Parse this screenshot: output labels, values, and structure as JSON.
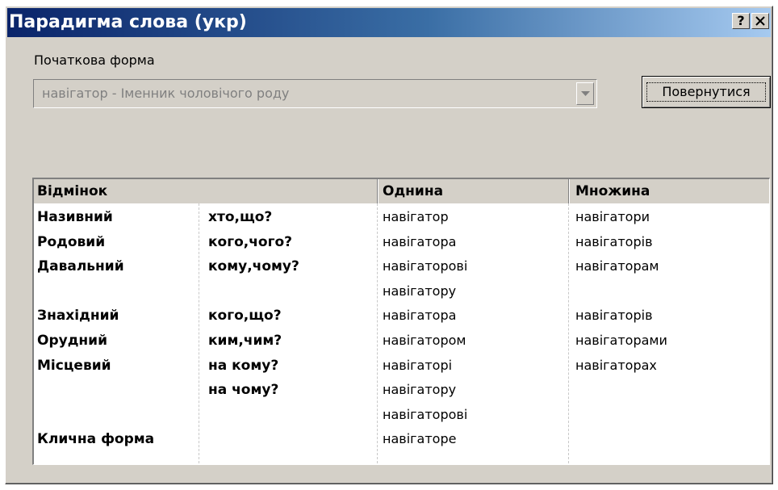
{
  "window": {
    "title": "Парадигма слова (укр)",
    "help_label": "?",
    "close_label": "✕"
  },
  "form": {
    "initial_form_label": "Початкова форма",
    "initial_form_value": "навігатор - Іменник чоловічого роду",
    "back_button_label": "Повернутися"
  },
  "table": {
    "headers": {
      "case": "Відмінок",
      "singular": "Однина",
      "plural": "Множина"
    },
    "rows": [
      {
        "case": "Називний",
        "question": "хто,що?",
        "singular": "навігатор",
        "plural": "навігатори"
      },
      {
        "case": "Родовий",
        "question": "кого,чого?",
        "singular": "навігатора",
        "plural": "навігаторів"
      },
      {
        "case": "Давальний",
        "question": "кому,чому?",
        "singular": "навігаторові",
        "plural": "навігаторам"
      },
      {
        "case": "",
        "question": "",
        "singular": "навігатору",
        "plural": ""
      },
      {
        "case": "Знахідний",
        "question": "кого,що?",
        "singular": "навігатора",
        "plural": "навігаторів"
      },
      {
        "case": "Орудний",
        "question": "ким,чим?",
        "singular": "навігатором",
        "plural": "навігаторами"
      },
      {
        "case": "Місцевий",
        "question": "на кому?",
        "singular": "навігаторі",
        "plural": "навігаторах"
      },
      {
        "case": "",
        "question": "на чому?",
        "singular": "навігатору",
        "plural": ""
      },
      {
        "case": "",
        "question": "",
        "singular": "навігаторові",
        "plural": ""
      },
      {
        "case": "Клична форма",
        "question": "",
        "singular": "навігаторе",
        "plural": ""
      }
    ]
  }
}
